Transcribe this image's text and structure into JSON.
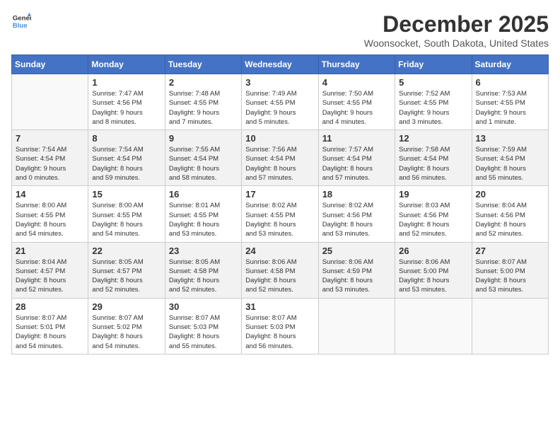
{
  "logo": {
    "text_general": "General",
    "text_blue": "Blue"
  },
  "title": "December 2025",
  "subtitle": "Woonsocket, South Dakota, United States",
  "weekdays": [
    "Sunday",
    "Monday",
    "Tuesday",
    "Wednesday",
    "Thursday",
    "Friday",
    "Saturday"
  ],
  "weeks": [
    [
      {
        "day": "",
        "info": ""
      },
      {
        "day": "1",
        "info": "Sunrise: 7:47 AM\nSunset: 4:56 PM\nDaylight: 9 hours\nand 8 minutes."
      },
      {
        "day": "2",
        "info": "Sunrise: 7:48 AM\nSunset: 4:55 PM\nDaylight: 9 hours\nand 7 minutes."
      },
      {
        "day": "3",
        "info": "Sunrise: 7:49 AM\nSunset: 4:55 PM\nDaylight: 9 hours\nand 5 minutes."
      },
      {
        "day": "4",
        "info": "Sunrise: 7:50 AM\nSunset: 4:55 PM\nDaylight: 9 hours\nand 4 minutes."
      },
      {
        "day": "5",
        "info": "Sunrise: 7:52 AM\nSunset: 4:55 PM\nDaylight: 9 hours\nand 3 minutes."
      },
      {
        "day": "6",
        "info": "Sunrise: 7:53 AM\nSunset: 4:55 PM\nDaylight: 9 hours\nand 1 minute."
      }
    ],
    [
      {
        "day": "7",
        "info": "Sunrise: 7:54 AM\nSunset: 4:54 PM\nDaylight: 9 hours\nand 0 minutes."
      },
      {
        "day": "8",
        "info": "Sunrise: 7:54 AM\nSunset: 4:54 PM\nDaylight: 8 hours\nand 59 minutes."
      },
      {
        "day": "9",
        "info": "Sunrise: 7:55 AM\nSunset: 4:54 PM\nDaylight: 8 hours\nand 58 minutes."
      },
      {
        "day": "10",
        "info": "Sunrise: 7:56 AM\nSunset: 4:54 PM\nDaylight: 8 hours\nand 57 minutes."
      },
      {
        "day": "11",
        "info": "Sunrise: 7:57 AM\nSunset: 4:54 PM\nDaylight: 8 hours\nand 57 minutes."
      },
      {
        "day": "12",
        "info": "Sunrise: 7:58 AM\nSunset: 4:54 PM\nDaylight: 8 hours\nand 56 minutes."
      },
      {
        "day": "13",
        "info": "Sunrise: 7:59 AM\nSunset: 4:54 PM\nDaylight: 8 hours\nand 55 minutes."
      }
    ],
    [
      {
        "day": "14",
        "info": "Sunrise: 8:00 AM\nSunset: 4:55 PM\nDaylight: 8 hours\nand 54 minutes."
      },
      {
        "day": "15",
        "info": "Sunrise: 8:00 AM\nSunset: 4:55 PM\nDaylight: 8 hours\nand 54 minutes."
      },
      {
        "day": "16",
        "info": "Sunrise: 8:01 AM\nSunset: 4:55 PM\nDaylight: 8 hours\nand 53 minutes."
      },
      {
        "day": "17",
        "info": "Sunrise: 8:02 AM\nSunset: 4:55 PM\nDaylight: 8 hours\nand 53 minutes."
      },
      {
        "day": "18",
        "info": "Sunrise: 8:02 AM\nSunset: 4:56 PM\nDaylight: 8 hours\nand 53 minutes."
      },
      {
        "day": "19",
        "info": "Sunrise: 8:03 AM\nSunset: 4:56 PM\nDaylight: 8 hours\nand 52 minutes."
      },
      {
        "day": "20",
        "info": "Sunrise: 8:04 AM\nSunset: 4:56 PM\nDaylight: 8 hours\nand 52 minutes."
      }
    ],
    [
      {
        "day": "21",
        "info": "Sunrise: 8:04 AM\nSunset: 4:57 PM\nDaylight: 8 hours\nand 52 minutes."
      },
      {
        "day": "22",
        "info": "Sunrise: 8:05 AM\nSunset: 4:57 PM\nDaylight: 8 hours\nand 52 minutes."
      },
      {
        "day": "23",
        "info": "Sunrise: 8:05 AM\nSunset: 4:58 PM\nDaylight: 8 hours\nand 52 minutes."
      },
      {
        "day": "24",
        "info": "Sunrise: 8:06 AM\nSunset: 4:58 PM\nDaylight: 8 hours\nand 52 minutes."
      },
      {
        "day": "25",
        "info": "Sunrise: 8:06 AM\nSunset: 4:59 PM\nDaylight: 8 hours\nand 53 minutes."
      },
      {
        "day": "26",
        "info": "Sunrise: 8:06 AM\nSunset: 5:00 PM\nDaylight: 8 hours\nand 53 minutes."
      },
      {
        "day": "27",
        "info": "Sunrise: 8:07 AM\nSunset: 5:00 PM\nDaylight: 8 hours\nand 53 minutes."
      }
    ],
    [
      {
        "day": "28",
        "info": "Sunrise: 8:07 AM\nSunset: 5:01 PM\nDaylight: 8 hours\nand 54 minutes."
      },
      {
        "day": "29",
        "info": "Sunrise: 8:07 AM\nSunset: 5:02 PM\nDaylight: 8 hours\nand 54 minutes."
      },
      {
        "day": "30",
        "info": "Sunrise: 8:07 AM\nSunset: 5:03 PM\nDaylight: 8 hours\nand 55 minutes."
      },
      {
        "day": "31",
        "info": "Sunrise: 8:07 AM\nSunset: 5:03 PM\nDaylight: 8 hours\nand 56 minutes."
      },
      {
        "day": "",
        "info": ""
      },
      {
        "day": "",
        "info": ""
      },
      {
        "day": "",
        "info": ""
      }
    ]
  ]
}
